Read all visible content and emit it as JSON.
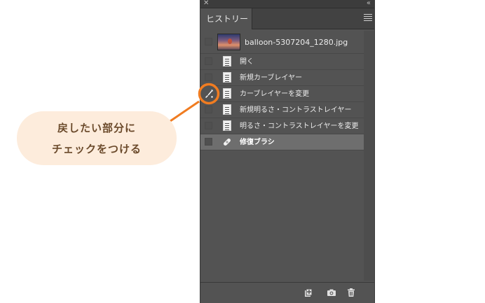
{
  "panel": {
    "tab_label": "ヒストリー",
    "snapshot": {
      "label": "balloon-5307204_1280.jpg"
    },
    "items": [
      {
        "label": "開く",
        "icon": "document-icon",
        "selected": false
      },
      {
        "label": "新規カーブレイヤー",
        "icon": "document-icon",
        "selected": false
      },
      {
        "label": "カーブレイヤーを変更",
        "icon": "document-icon",
        "selected": false,
        "history_brush_source": true
      },
      {
        "label": "新規明るさ・コントラストレイヤー",
        "icon": "document-icon",
        "selected": false
      },
      {
        "label": "明るさ・コントラストレイヤーを変更",
        "icon": "document-icon",
        "selected": false
      },
      {
        "label": "修復ブラシ",
        "icon": "healing-brush-icon",
        "selected": true
      }
    ]
  },
  "callout": {
    "line1": "戻したい部分に",
    "line2": "チェックをつける"
  },
  "colors": {
    "accent": "#f07c21",
    "callout_bg": "#fdecdc",
    "callout_text": "#6b4a2b",
    "panel_bg": "#535353",
    "selected_row": "#6e6e6e"
  }
}
